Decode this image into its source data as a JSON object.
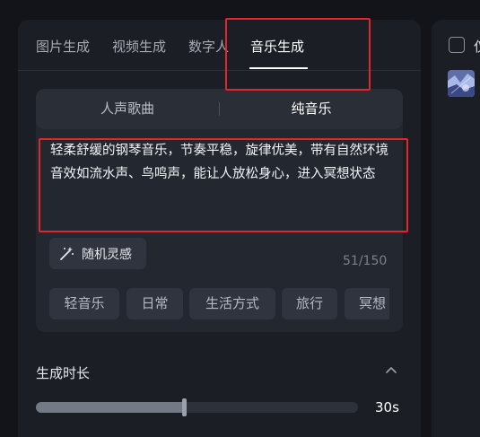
{
  "tabs": [
    {
      "label": "图片生成",
      "active": false
    },
    {
      "label": "视频生成",
      "active": false
    },
    {
      "label": "数字人",
      "active": false
    },
    {
      "label": "音乐生成",
      "active": true
    }
  ],
  "mode": {
    "options": [
      "人声歌曲",
      "纯音乐"
    ],
    "selected": "纯音乐"
  },
  "prompt": {
    "text": "轻柔舒缓的钢琴音乐，节奏平稳，旋律优美，带有自然环境音效如流水声、鸟鸣声，能让人放松身心，进入冥想状态"
  },
  "random_button": {
    "label": "随机灵感",
    "icon": "magic-wand-icon"
  },
  "char_counter": "51/150",
  "tags": [
    "轻音乐",
    "日常",
    "生活方式",
    "旅行",
    "冥想"
  ],
  "duration": {
    "title": "生成时长",
    "value_label": "30s",
    "slider_fraction": 0.46,
    "collapse_icon": "chevron-up-icon"
  },
  "right_panel": {
    "checkbox_checked": false,
    "label_partial": "仅"
  },
  "colors": {
    "background": "#121419",
    "panel": "#1b1e25",
    "highlight_box": "#e2262b"
  }
}
